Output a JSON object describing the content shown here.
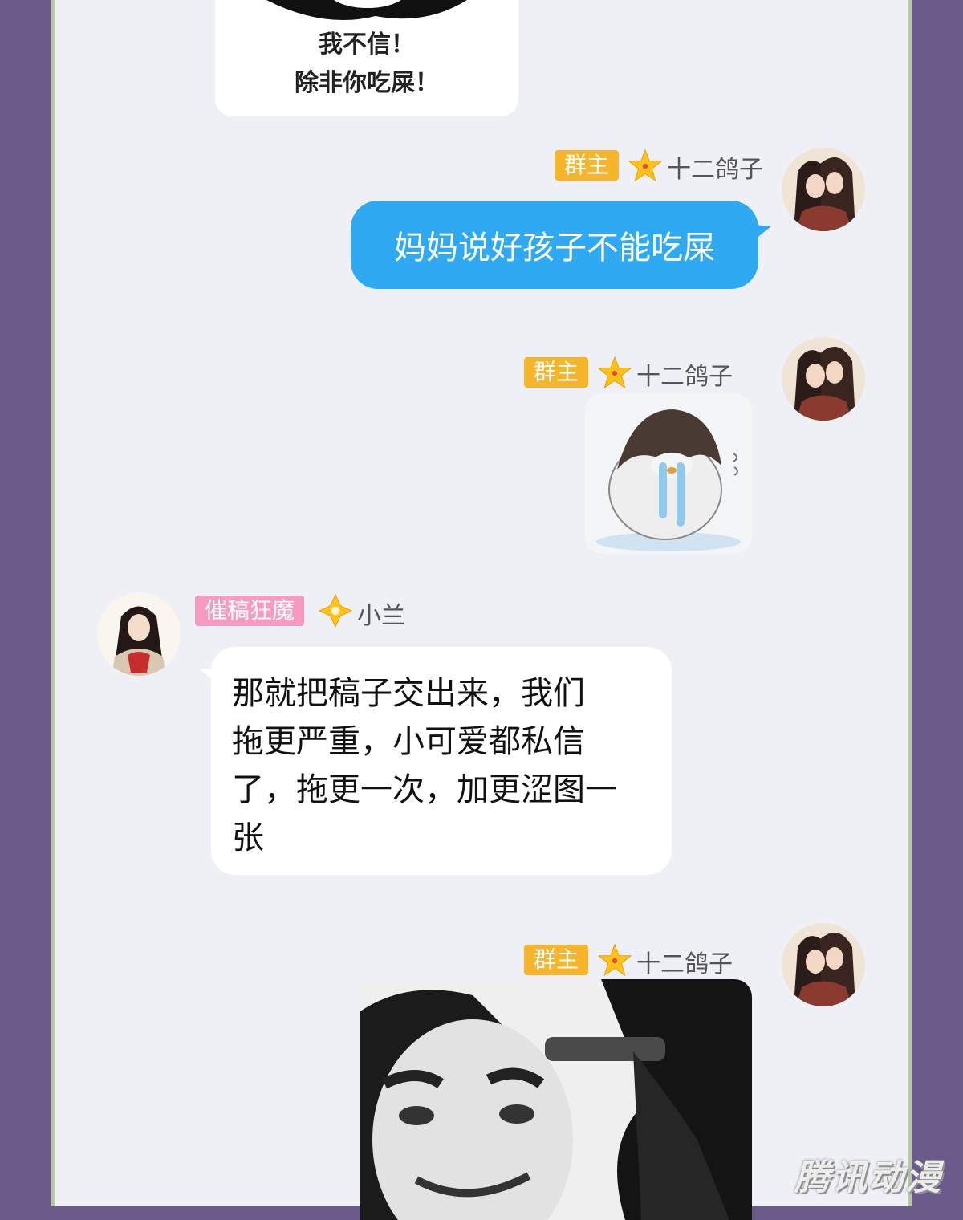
{
  "top_sticker": {
    "lines": [
      "我不信！",
      "除非你吃屎！"
    ]
  },
  "messages": [
    {
      "badge": "群主",
      "sender": "十二鸽子",
      "text": "妈妈说好孩子不能吃屎"
    },
    {
      "badge": "群主",
      "sender": "十二鸽子",
      "sticker": "crying-penguin"
    },
    {
      "badge": "催稿狂魔",
      "sender": "小兰",
      "text": "那就把稿子交出来，我们\n拖更严重，小可爱都私信\n了，拖更一次，加更涩图一\n张"
    },
    {
      "badge": "群主",
      "sender": "十二鸽子",
      "sticker": "gun-to-head-meme"
    }
  ],
  "watermark": "腾讯动漫",
  "colors": {
    "background": "#6b5a8a",
    "chat_bg": "#eef0f5",
    "owner_badge": "#f7b52c",
    "pink_badge": "#f59ac0",
    "blue_bubble": "#2fa9f2"
  }
}
